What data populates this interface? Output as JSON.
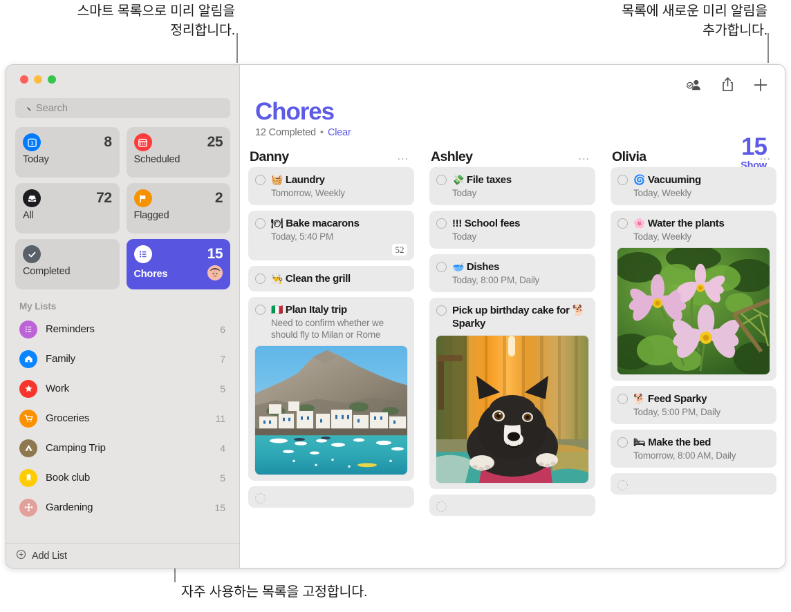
{
  "annotations": {
    "top_left": "스마트 목록으로 미리 알림을\n정리합니다.",
    "top_left_line1": "스마트 목록으로 미리 알림을",
    "top_left_line2": "정리합니다.",
    "top_right_line1": "목록에 새로운 미리 알림을",
    "top_right_line2": "추가합니다.",
    "bottom": "자주 사용하는 목록을 고정합니다."
  },
  "sidebar": {
    "search": {
      "placeholder": "Search",
      "value": "",
      "icon": "search-icon"
    },
    "tiles": [
      {
        "label": "Today",
        "count": "8",
        "icon": "today-calendar-icon",
        "color": "#007aff",
        "selected": false
      },
      {
        "label": "Scheduled",
        "count": "25",
        "icon": "scheduled-calendar-icon",
        "color": "#fc3b3b",
        "selected": false
      },
      {
        "label": "All",
        "count": "72",
        "icon": "all-inbox-icon",
        "color": "#1d1d1f",
        "selected": false
      },
      {
        "label": "Flagged",
        "count": "2",
        "icon": "flag-icon",
        "color": "#f79200",
        "selected": false
      },
      {
        "label": "Completed",
        "count": "",
        "icon": "checkmark-icon",
        "color": "#5a6069",
        "selected": false
      },
      {
        "label": "Chores",
        "count": "15",
        "icon": "list-bullet-icon",
        "color": "#ffffff",
        "selected": true,
        "avatar": "shared-avatar"
      }
    ],
    "my_lists_header": "My Lists",
    "lists": [
      {
        "name": "Reminders",
        "count": "6",
        "icon": "list-bullet-icon",
        "color": "#bc63d8"
      },
      {
        "name": "Family",
        "count": "7",
        "icon": "house-icon",
        "color": "#0a84ff"
      },
      {
        "name": "Work",
        "count": "5",
        "icon": "star-icon",
        "color": "#f8352c"
      },
      {
        "name": "Groceries",
        "count": "11",
        "icon": "cart-icon",
        "color": "#fb9000"
      },
      {
        "name": "Camping Trip",
        "count": "4",
        "icon": "tent-icon",
        "color": "#8d7850"
      },
      {
        "name": "Book club",
        "count": "5",
        "icon": "bookmark-icon",
        "color": "#ffcc00"
      },
      {
        "name": "Gardening",
        "count": "15",
        "icon": "flower-icon",
        "color": "#e2a09b"
      }
    ],
    "add_list": {
      "label": "Add List",
      "icon": "plus-circle-icon"
    }
  },
  "toolbar": {
    "share_people_label": "share-people",
    "share_label": "share",
    "add_label": "add"
  },
  "header": {
    "title": "Chores",
    "completed_text": "12 Completed",
    "separator": "•",
    "clear_label": "Clear",
    "count": "15",
    "show_label": "Show",
    "accent_color": "#5d5ae6"
  },
  "columns": [
    {
      "name": "Danny",
      "menu": "...",
      "items": [
        {
          "emoji": "🧺",
          "title": "Laundry",
          "sub": "Tomorrow, Weekly"
        },
        {
          "emoji": "🍽",
          "title": "Bake macarons",
          "sub": "Today, 5:40 PM",
          "badge": "52"
        },
        {
          "emoji": "👨‍🍳",
          "title": "Clean the grill",
          "sub": ""
        },
        {
          "emoji": "🇮🇹",
          "title": "Plan Italy trip",
          "sub": "Need to confirm whether we should fly to Milan or Rome",
          "photo": "italy-coastal-village"
        },
        {
          "emoji": "",
          "title": "",
          "sub": "",
          "empty": true
        }
      ]
    },
    {
      "name": "Ashley",
      "menu": "...",
      "items": [
        {
          "emoji": "💸",
          "title": "File taxes",
          "sub": "Today"
        },
        {
          "emoji": "!!!",
          "title": "School fees",
          "sub": "Today"
        },
        {
          "emoji": "🥣",
          "title": "Dishes",
          "sub": "Today, 8:00 PM, Daily"
        },
        {
          "emoji": "🐕",
          "title": "Pick up birthday cake for 🐕 Sparky",
          "sub": "",
          "photo": "boston-terrier-dog"
        },
        {
          "emoji": "",
          "title": "",
          "sub": "",
          "empty": true
        }
      ]
    },
    {
      "name": "Olivia",
      "menu": "...",
      "items": [
        {
          "emoji": "🌀",
          "title": "Vacuuming",
          "sub": "Today, Weekly"
        },
        {
          "emoji": "🌸",
          "title": "Water the plants",
          "sub": "Today, Weekly",
          "photo": "pink-cosmos-flowers"
        },
        {
          "emoji": "🐕",
          "title": "Feed Sparky",
          "sub": "Today, 5:00 PM, Daily"
        },
        {
          "emoji": "🛏",
          "title": "Make the bed",
          "sub": "Tomorrow, 8:00 AM, Daily"
        },
        {
          "emoji": "",
          "title": "",
          "sub": "",
          "empty": true
        }
      ]
    }
  ]
}
